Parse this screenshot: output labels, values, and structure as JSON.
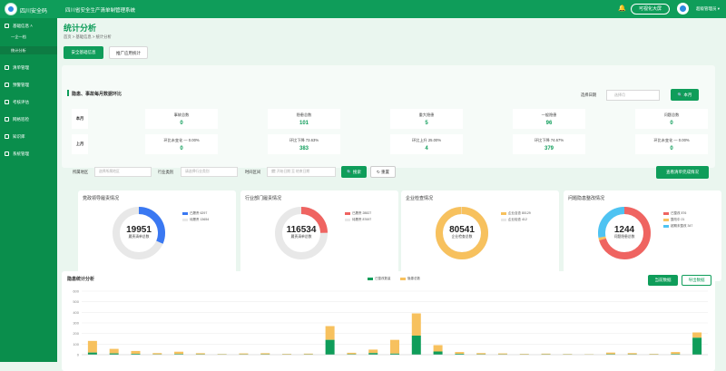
{
  "header": {
    "brand": "四川安全码",
    "system_name": "四川省安全生产清单制管理系统",
    "bigscreen": "可视化大屏",
    "user": "超级管理员"
  },
  "sidebar": {
    "items": [
      {
        "label": "基础信息",
        "children": [
          {
            "label": "一企一档",
            "active": false
          },
          {
            "label": "统计分析",
            "active": true
          }
        ]
      },
      {
        "label": "清单管理"
      },
      {
        "label": "预警管理"
      },
      {
        "label": "考核评估"
      },
      {
        "label": "网格巡检"
      },
      {
        "label": "知识库"
      },
      {
        "label": "系统管理"
      }
    ]
  },
  "page": {
    "title": "统计分析",
    "breadcrumb": "首页 > 基础信息 > 统计分析",
    "tabs": [
      "安全基础信息",
      "推广应用统计"
    ]
  },
  "compare": {
    "title": "隐患、事故每月数据环比",
    "date_label": "选择日期",
    "date_placeholder": "选择月",
    "month_btn": "本月",
    "columns": [
      "事故总数",
      "隐患总数",
      "重大隐患",
      "一般隐患",
      "问题总数"
    ],
    "rows": [
      {
        "label": "本月",
        "values": [
          "0",
          "101",
          "5",
          "96",
          "0"
        ]
      },
      {
        "label": "上月",
        "values": [
          "0",
          "383",
          "4",
          "379",
          "0"
        ],
        "changes": [
          {
            "text": "环比未变化 — 0.00%",
            "dir": "none"
          },
          {
            "text": "环比下降 73.63%",
            "dir": "down"
          },
          {
            "text": "环比上升 25.00%",
            "dir": "up"
          },
          {
            "text": "环比下降 74.67%",
            "dir": "down"
          },
          {
            "text": "环比未变化 — 0.00%",
            "dir": "none"
          }
        ]
      }
    ]
  },
  "filters": {
    "region_label": "所属地区",
    "region_placeholder": "选择所属地区",
    "industry_label": "行业类别",
    "industry_placeholder": "请选择行业类别",
    "time_label": "时间区间",
    "start_placeholder": "开始日期",
    "sep": "至",
    "end_placeholder": "结束日期",
    "search": "搜索",
    "reset": "重置",
    "report": "查看清单完成情况"
  },
  "donuts": [
    {
      "title": "党政领导履责情况",
      "total": "19951",
      "center_label": "履责清单总数",
      "legend": [
        {
          "name": "已履责",
          "value": "6297",
          "color": "#3a78f2"
        },
        {
          "name": "待履责",
          "value": "13654",
          "color": "#e8e8e8"
        }
      ]
    },
    {
      "title": "行业部门履责情况",
      "total": "116534",
      "center_label": "履责清单总数",
      "legend": [
        {
          "name": "已履责",
          "value": "28827",
          "color": "#ef6461"
        },
        {
          "name": "待履责",
          "value": "87697",
          "color": "#e8e8e8"
        }
      ]
    },
    {
      "title": "企业检查情况",
      "total": "80541",
      "center_label": "企业检查总数",
      "legend": [
        {
          "name": "企业自查",
          "value": "80129",
          "color": "#f7c15e"
        },
        {
          "name": "企业检查",
          "value": "412",
          "color": "#e8e8e8"
        }
      ]
    },
    {
      "title": "问题隐患整改情况",
      "total": "1244",
      "center_label": "问题隐患总数",
      "legend": [
        {
          "name": "已整改",
          "value": "876",
          "color": "#ef6461"
        },
        {
          "name": "整改中",
          "value": "21",
          "color": "#f7c15e"
        },
        {
          "name": "超期未整改",
          "value": "347",
          "color": "#4ec3f2"
        }
      ]
    }
  ],
  "trend": {
    "title": "隐患统计分析",
    "current_btn": "当前数据",
    "export_btn": "导出数据"
  },
  "chart_data": {
    "type": "bar",
    "stacked": true,
    "series": [
      {
        "name": "已整改数量",
        "color": "#0f9d5a",
        "values": [
          20,
          12,
          8,
          3,
          6,
          4,
          2,
          3,
          4,
          2,
          3,
          140,
          5,
          15,
          10,
          180,
          30,
          8,
          4,
          3,
          2,
          3,
          2,
          1,
          5,
          4,
          2,
          6,
          160
        ]
      },
      {
        "name": "隐患总数",
        "color": "#f7c15e",
        "values": [
          130,
          55,
          35,
          15,
          28,
          14,
          7,
          12,
          14,
          8,
          10,
          270,
          18,
          48,
          140,
          390,
          90,
          25,
          15,
          12,
          8,
          10,
          7,
          5,
          20,
          15,
          8,
          25,
          210
        ]
      }
    ],
    "ylim": [
      0,
      600
    ],
    "yticks": [
      0,
      100,
      200,
      300,
      400,
      500,
      600
    ]
  }
}
